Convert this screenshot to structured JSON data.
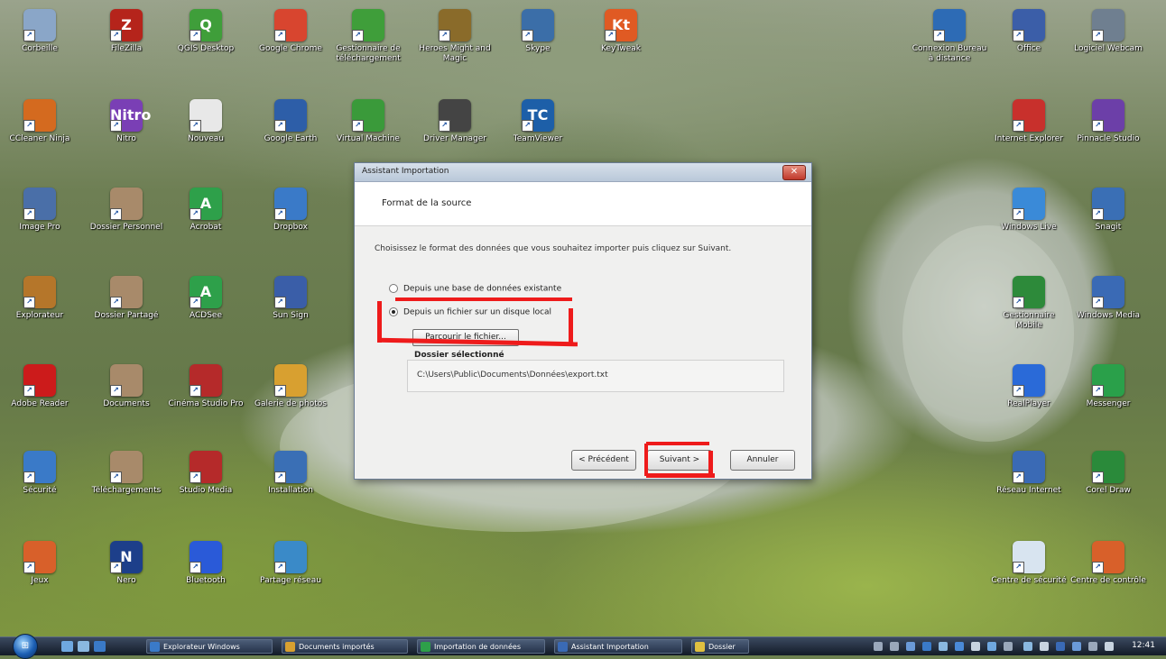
{
  "desktop": {
    "icons": [
      {
        "label": "Corbeille",
        "letter": "",
        "color": "#8aa6c8"
      },
      {
        "label": "FileZilla",
        "letter": "Z",
        "color": "#b5241b"
      },
      {
        "label": "QGIS Desktop",
        "letter": "Q",
        "color": "#3f9e3a"
      },
      {
        "label": "Google Chrome",
        "letter": "",
        "color": "#d8452f"
      },
      {
        "label": "Gestionnaire de téléchargement",
        "letter": "",
        "color": "#3f9e3a"
      },
      {
        "label": "Heroes Might and Magic",
        "letter": "",
        "color": "#8a6b2a"
      },
      {
        "label": "Skype",
        "letter": "",
        "color": "#3b6ea8"
      },
      {
        "label": "KeyTweak",
        "letter": "Kt",
        "color": "#e05a23"
      },
      {
        "label": "Connexion Bureau à distance",
        "letter": "",
        "color": "#2d6bb5"
      },
      {
        "label": "Office",
        "letter": "",
        "color": "#3b5ea8"
      },
      {
        "label": "Logiciel Webcam",
        "letter": "",
        "color": "#6f7f90"
      },
      {
        "label": "CCleaner Ninja",
        "letter": "",
        "color": "#d46a1f"
      },
      {
        "label": "Nitro",
        "letter": "Nitro",
        "color": "#7a3fb5"
      },
      {
        "label": "Nouveau",
        "letter": "",
        "color": "#e8e8e8"
      },
      {
        "label": "Google Earth",
        "letter": "",
        "color": "#2d5ea8"
      },
      {
        "label": "Virtual Machine",
        "letter": "",
        "color": "#3a9a3a"
      },
      {
        "label": "Driver Manager",
        "letter": "",
        "color": "#444444"
      },
      {
        "label": "TeamViewer",
        "letter": "TC",
        "color": "#1d5fa8"
      },
      {
        "label": "Internet Explorer",
        "letter": "",
        "color": "#c8302c"
      },
      {
        "label": "Pinnacle Studio",
        "letter": "",
        "color": "#6c3fa8"
      },
      {
        "label": "Image Pro",
        "letter": "",
        "color": "#4a6fa8"
      },
      {
        "label": "Dossier Personnel",
        "letter": "",
        "color": "#a88a6a"
      },
      {
        "label": "Acrobat",
        "letter": "A",
        "color": "#2ea04a"
      },
      {
        "label": "Dropbox",
        "letter": "",
        "color": "#3a7ac8"
      },
      {
        "label": "Windows Live",
        "letter": "",
        "color": "#3a8ad8"
      },
      {
        "label": "Snagit",
        "letter": "",
        "color": "#3a6fb5"
      },
      {
        "label": "Explorateur",
        "letter": "",
        "color": "#b5762a"
      },
      {
        "label": "Dossier Partagé",
        "letter": "",
        "color": "#a88a6a"
      },
      {
        "label": "ACDSee",
        "letter": "A",
        "color": "#2ea04a"
      },
      {
        "label": "Sun Sign",
        "letter": "",
        "color": "#3a5ea8"
      },
      {
        "label": "Gestionnaire Mobile",
        "letter": "",
        "color": "#2d8a3a"
      },
      {
        "label": "Windows Media",
        "letter": "",
        "color": "#3a6ab5"
      },
      {
        "label": "Adobe Reader",
        "letter": "",
        "color": "#cc1b1b"
      },
      {
        "label": "Documents",
        "letter": "",
        "color": "#a88a6a"
      },
      {
        "label": "Cinéma Studio Pro",
        "letter": "",
        "color": "#b52a2a"
      },
      {
        "label": "Galerie de photos",
        "letter": "",
        "color": "#d8a030"
      },
      {
        "label": "RealPlayer",
        "letter": "",
        "color": "#2a6ad8"
      },
      {
        "label": "Messenger",
        "letter": "",
        "color": "#2aa04a"
      },
      {
        "label": "Sécurité",
        "letter": "",
        "color": "#3a7ac8"
      },
      {
        "label": "Téléchargements",
        "letter": "",
        "color": "#a88a6a"
      },
      {
        "label": "Studio Media",
        "letter": "",
        "color": "#b52a2a"
      },
      {
        "label": "Installation",
        "letter": "",
        "color": "#3a6fb5"
      },
      {
        "label": "Réseau Internet",
        "letter": "",
        "color": "#3a6ab5"
      },
      {
        "label": "Corel Draw",
        "letter": "",
        "color": "#2a8a3a"
      },
      {
        "label": "Jeux",
        "letter": "",
        "color": "#d8602a"
      },
      {
        "label": "Nero",
        "letter": "N",
        "color": "#1d3f8a"
      },
      {
        "label": "Bluetooth",
        "letter": "",
        "color": "#2a5ad8"
      },
      {
        "label": "Partage réseau",
        "letter": "",
        "color": "#3a8ac8"
      },
      {
        "label": "Centre de sécurité",
        "letter": "",
        "color": "#d8e4f0"
      },
      {
        "label": "Centre de contrôle",
        "letter": "",
        "color": "#d8602a"
      }
    ]
  },
  "dialog": {
    "title": "Assistant Importation",
    "header": "Format de la source",
    "description": "Choisissez le format des données que vous souhaitez importer puis cliquez sur Suivant.",
    "options": [
      {
        "label": "Depuis une base de données existante",
        "selected": false
      },
      {
        "label": "Depuis un fichier sur un disque local",
        "selected": true
      }
    ],
    "browse_label": "Parcourir le fichier...",
    "selection_group_label": "Dossier sélectionné",
    "selection_value": "C:\\Users\\Public\\Documents\\Données\\export.txt",
    "back_label": "< Précédent",
    "next_label": "Suivant >",
    "cancel_label": "Annuler",
    "close_symbol": "✕"
  },
  "taskbar": {
    "start_symbol": "⊞",
    "tasks": [
      {
        "label": "Explorateur Windows",
        "color": "#3a7ac8"
      },
      {
        "label": "Documents importés",
        "color": "#d8a030"
      },
      {
        "label": "Importation de données",
        "color": "#2ea04a"
      },
      {
        "label": "Assistant Importation",
        "color": "#3a6ab5"
      },
      {
        "label": "Dossier",
        "color": "#e0c040"
      }
    ],
    "clock": "12:41"
  },
  "colors": {
    "annotation_red": "#ee1b1b"
  }
}
